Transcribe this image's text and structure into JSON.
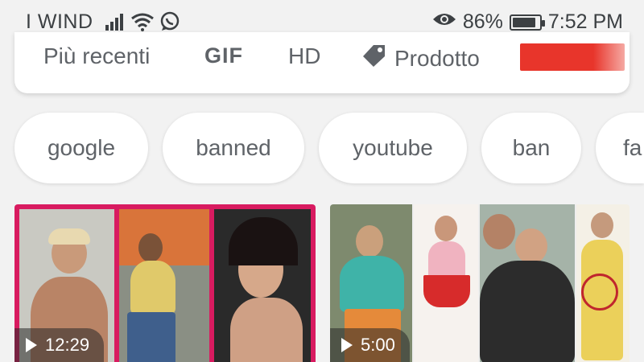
{
  "status_bar": {
    "carrier": "I WIND",
    "battery_percent": "86%",
    "battery_level": 0.86,
    "time": "7:52 PM",
    "icons": [
      "signal-icon",
      "wifi-icon",
      "whatsapp-icon",
      "eye-icon",
      "battery-icon"
    ]
  },
  "filters": {
    "recent": "Più recenti",
    "gif": "GIF",
    "hd": "HD",
    "product": "Prodotto",
    "accent": "#e8352b"
  },
  "chips": [
    "google",
    "banned",
    "youtube",
    "ban",
    "fa"
  ],
  "videos": [
    {
      "duration": "12:29"
    },
    {
      "duration": "5:00"
    }
  ],
  "colors": {
    "background": "#f2f2f2",
    "card": "#ffffff",
    "text": "#5f6368"
  }
}
